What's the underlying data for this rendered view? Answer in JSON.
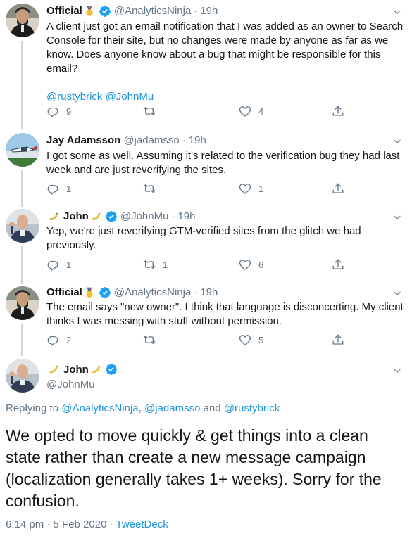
{
  "tweets": [
    {
      "name": "Official",
      "handle": "@AnalyticsNinja",
      "separator": "·",
      "time": "19h",
      "text_lines": [
        "A client just got an email notification that I was added as an owner to Search",
        "Console for their site, but no changes were made by anyone as far as we",
        "know.  Does anyone know about a bug that might be responsible for this",
        "email?"
      ],
      "mentions": "@rustybrick @JohnMu",
      "reply_count": "9",
      "retweet_count": "",
      "like_count": "4"
    },
    {
      "name": "Jay Adamsson",
      "handle": "@jadamsso",
      "separator": "·",
      "time": "19h",
      "text_lines": [
        "I got some as well. Assuming it's related to the verification bug they had last",
        "week and are just reverifying the sites."
      ],
      "reply_count": "1",
      "retweet_count": "",
      "like_count": "1"
    },
    {
      "name": "John",
      "handle": "@JohnMu",
      "separator": "·",
      "time": "19h",
      "text_lines": [
        "Yep, we're just reverifying GTM-verified sites from the glitch we had",
        "previously."
      ],
      "reply_count": "1",
      "retweet_count": "1",
      "like_count": "6"
    },
    {
      "name": "Official",
      "handle": "@AnalyticsNinja",
      "separator": "·",
      "time": "19h",
      "text_lines": [
        "The email says \"new owner\". I think that language is disconcerting. My client",
        "thinks I was messing with stuff without permission."
      ],
      "reply_count": "2",
      "retweet_count": "",
      "like_count": "5"
    }
  ],
  "main_tweet": {
    "name": "John",
    "handle": "@JohnMu",
    "replying_prefix": "Replying to",
    "replying_1": "@AnalyticsNinja",
    "replying_sep1": ",",
    "replying_2": "@jadamsso",
    "replying_and": "and",
    "replying_3": "@rustybrick",
    "text_lines": [
      "We opted to move quickly & get things into a clean",
      "state rather than create a new message campaign",
      "(localization generally takes 1+ weeks). Sorry for the",
      "confusion."
    ],
    "time": "6:14 pm",
    "date": "5 Feb 2020",
    "source": "TweetDeck",
    "meta_sep": "·"
  },
  "icons": {
    "verified": "verified-badge-icon",
    "medal": "medal-emoji-icon",
    "banana": "banana-emoji-icon",
    "reply": "reply-icon",
    "retweet": "retweet-icon",
    "like": "heart-icon",
    "share": "share-icon",
    "caret": "chevron-down-icon"
  },
  "colors": {
    "link": "#1b95e0",
    "muted": "#657786",
    "verified": "#1da1f2",
    "text": "#14171a"
  }
}
